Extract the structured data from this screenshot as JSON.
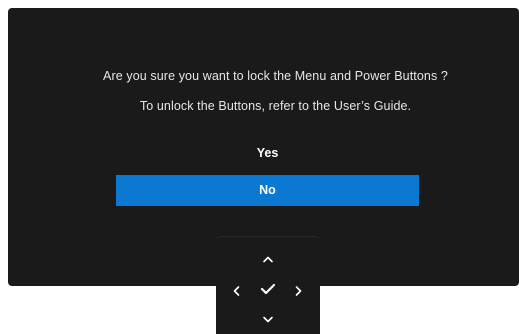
{
  "dialog": {
    "message_line_1": "Are you sure you want to lock the Menu and Power Buttons ?",
    "message_line_2": "To unlock the Buttons, refer to the User’s Guide.",
    "options": [
      {
        "label": "Yes",
        "selected": false
      },
      {
        "label": "No",
        "selected": true
      }
    ]
  },
  "nav_pad": {
    "buttons": [
      "chevron-up-icon",
      "chevron-left-icon",
      "check-icon",
      "chevron-right-icon",
      "chevron-down-icon"
    ]
  },
  "colors": {
    "background": "#1a1a1a",
    "highlight": "#0b78d2",
    "text": "#e6e6e6"
  }
}
